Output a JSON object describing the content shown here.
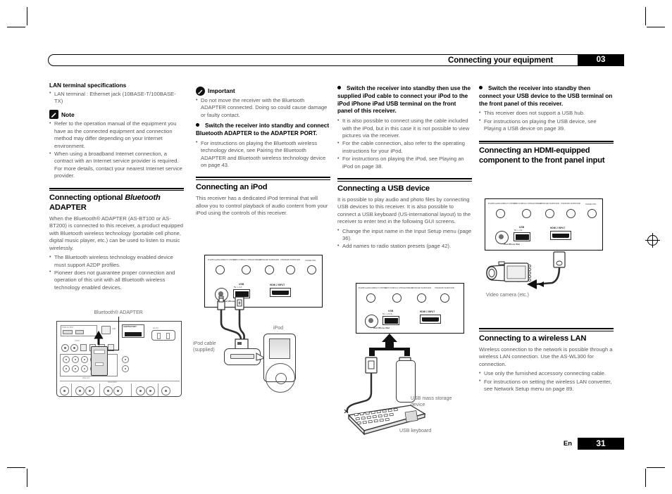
{
  "header": {
    "title": "Connecting your equipment",
    "chapter": "03"
  },
  "footer": {
    "language": "En",
    "page": "31"
  },
  "col1": {
    "lan_heading": "LAN terminal specifications",
    "lan_bullets": [
      "LAN terminal : Ethernet jack (10BASE-T/100BASE-TX)"
    ],
    "note_label": "Note",
    "note_bullets": [
      "Refer to the operation manual of the equipment you have as the connected equipment and connection method may differ depending on your Internet environment.",
      "When using a broadband Internet connection, a contract with an Internet service provider is required. For more details, contact your nearest Internet service provider."
    ],
    "bt_heading_1": "Connecting optional ",
    "bt_heading_em": "Bluetooth",
    "bt_heading_2": "ADAPTER",
    "bt_para": "When the Bluetooth® ADAPTER (AS-BT100 or AS-BT200) is connected to this receiver, a product equipped with Bluetooth wireless technology (portable cell phone, digital music player, etc.) can be used to listen to music wirelessly.",
    "bt_bullets": [
      "The Bluetooth wireless technology enabled device must support A2DP profiles.",
      "Pioneer does not guarantee proper connection and operation of this unit with all Bluetooth wireless technology enabled devices."
    ],
    "fig_caption": "Bluetooth® ADAPTER",
    "rear_labels": {
      "hdmi_out": "HDMI OUTPUT",
      "lan": "LAN",
      "adapter_port": "ADAPTER PORT",
      "ac_in": "AC IN",
      "pre_out": "PRE OUT",
      "video": "VIDEO",
      "speakers": "SPEAKERS"
    }
  },
  "col2": {
    "important_label": "Important",
    "important_bullets": [
      "Do not move the receiver with the Bluetooth ADAPTER connected. Doing so could cause damage or faulty contact."
    ],
    "step_text": "Switch the receiver into standby and connect Bluetooth ADAPTER to the ADAPTER PORT.",
    "step_bullets": [
      "For instructions on playing the Bluetooth wireless technology device, see Pairing the Bluetooth ADAPTER and Bluetooth wireless technology device on page 43."
    ],
    "ipod_heading": "Connecting an iPod",
    "ipod_para": "This receiver has a dedicated iPod terminal that will allow you to control playback of audio content from your iPod using the controls of this receiver.",
    "panel_labels": [
      "iPod/iPhone/iPad DIRECT CONTROL",
      "AUTO SURR/ALC STREAM DIRECT",
      "ADVANCED SURROUND",
      "STANDARD SURROUND",
      "PHASE CTRL"
    ],
    "usb_label": "USB",
    "usb_sub": "5V ⎓ 1 A",
    "port_label": "iPod iPhone iPad",
    "hdmi_label": "HDMI 2 INPUT",
    "cable_caption": "iPod cable (supplied)",
    "ipod_caption": "iPod"
  },
  "col3": {
    "step_text": "Switch the receiver into standby then use the supplied iPod cable to connect your iPod to the iPod iPhone iPad USB terminal on the front panel of this receiver.",
    "step_bullets": [
      "It is also possible to connect using the cable included with the iPod, but in this case it is not possible to view pictures via the receiver.",
      "For the cable connection, also refer to the operating instructions for your iPod.",
      "For instructions on playing the iPod, see Playing an iPod on page 38."
    ],
    "usb_heading": "Connecting a USB device",
    "usb_para": "It is possible to play audio and photo files by connecting USB devices to this receiver. It is also possible to connect a USB keyboard (US-international layout) to the receiver to enter text in the following GUI screens.",
    "usb_bullets": [
      "Change the input name in the Input Setup menu (page 36).",
      "Add names to radio station presets (page 42)."
    ],
    "panel_labels": [
      "iPod/iPhone/iPad DIRECT CONTROL",
      "AUTO SURR/ALC STREAM DIRECT",
      "ADVANCED SURROUND",
      "STANDARD SURROUND"
    ],
    "usb_label": "USB",
    "usb_sub": "5V ⎓ 2.1 A",
    "port_label": "iPod iPhone iPad",
    "hdmi_label": "HDMI 2 INPUT",
    "stick_caption": "USB mass storage device",
    "kbd_caption": "USB keyboard"
  },
  "col4": {
    "step_text": "Switch the receiver into standby then connect your USB device to the USB terminal on the front panel of this receiver.",
    "step_bullets": [
      "This receiver does not support a USB hub.",
      "For instructions on playing the USB device, see Playing a USB device on page 39."
    ],
    "hdmi_heading": "Connecting an HDMI-equipped component to the front panel input",
    "panel_labels": [
      "iPod/iPhone/iPad DIRECT CONTROL",
      "AUTO SURR/ALC STREAM DIRECT",
      "ADVANCED SURROUND",
      "STANDARD SURROUND",
      "PHASE CTRL"
    ],
    "usb_label": "USB",
    "usb_sub": "5V ⎓ 1 A",
    "port_label": "iPod iPhone iPad",
    "hdmi_label": "HDMI 2 INPUT",
    "camera_caption": "Video camera (etc.)",
    "wlan_heading": "Connecting to a wireless LAN",
    "wlan_para": "Wireless connection to the network is possible through a wireless LAN connection. Use the AS-WL300 for connection.",
    "wlan_bullets": [
      "Use only the furnished accessory connecting cable.",
      "For instructions on setting the wireless LAN converter, see Network Setup menu on page 89."
    ]
  }
}
